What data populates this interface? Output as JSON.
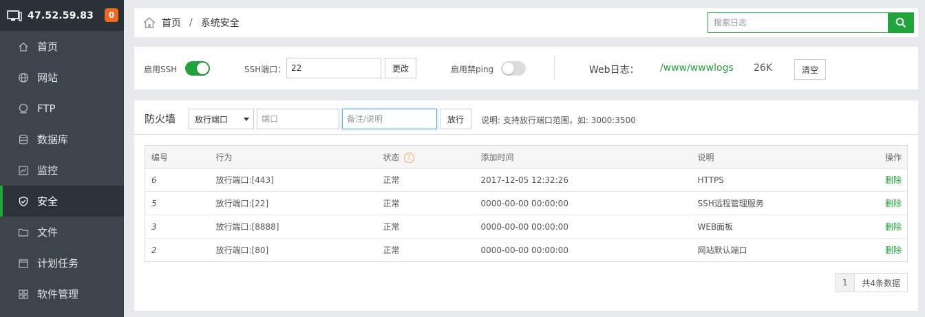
{
  "sidebar": {
    "server_ip": "47.52.59.83",
    "badge_count": "0",
    "items": [
      {
        "label": "首页",
        "icon": "home-icon"
      },
      {
        "label": "网站",
        "icon": "globe-icon"
      },
      {
        "label": "FTP",
        "icon": "ftp-icon"
      },
      {
        "label": "数据库",
        "icon": "database-icon"
      },
      {
        "label": "监控",
        "icon": "monitor-chart-icon"
      },
      {
        "label": "安全",
        "icon": "shield-icon"
      },
      {
        "label": "文件",
        "icon": "folder-icon"
      },
      {
        "label": "计划任务",
        "icon": "calendar-icon"
      },
      {
        "label": "软件管理",
        "icon": "grid-icon"
      }
    ],
    "active_index": 5
  },
  "breadcrumb": {
    "home": "首页",
    "separator": "/",
    "current": "系统安全"
  },
  "search": {
    "placeholder": "搜索日志"
  },
  "settings": {
    "ssh_label": "启用SSH",
    "ssh_enabled": true,
    "ssh_port_label": "SSH端口：",
    "ssh_port_value": "22",
    "change_button": "更改",
    "ping_label": "启用禁ping",
    "ping_enabled": false,
    "weblog_label": "Web日志：",
    "weblog_path": "/www/wwwlogs",
    "weblog_size": "26K",
    "clear_button": "清空"
  },
  "firewall": {
    "title": "防火墙",
    "action_select": "放行端口",
    "port_placeholder": "端口",
    "note_placeholder": "备注/说明",
    "allow_button": "放行",
    "hint": "说明: 支持放行端口范围，如: 3000:3500",
    "columns": [
      "编号",
      "行为",
      "状态",
      "添加时间",
      "说明",
      "操作"
    ],
    "rows": [
      {
        "id": "6",
        "action": "放行端口:[443]",
        "status": "正常",
        "time": "2017-12-05 12:32:26",
        "note": "HTTPS",
        "op": "删除"
      },
      {
        "id": "5",
        "action": "放行端口:[22]",
        "status": "正常",
        "time": "0000-00-00 00:00:00",
        "note": "SSH远程管理服务",
        "op": "删除"
      },
      {
        "id": "3",
        "action": "放行端口:[8888]",
        "status": "正常",
        "time": "0000-00-00 00:00:00",
        "note": "WEB面板",
        "op": "删除"
      },
      {
        "id": "2",
        "action": "放行端口:[80]",
        "status": "正常",
        "time": "0000-00-00 00:00:00",
        "note": "网站默认端口",
        "op": "删除"
      }
    ],
    "pager": {
      "page": "1",
      "total": "共4条数据"
    }
  },
  "colors": {
    "accent": "#20a53a",
    "sidebar_bg": "#3c444d",
    "badge": "#f0681e"
  }
}
